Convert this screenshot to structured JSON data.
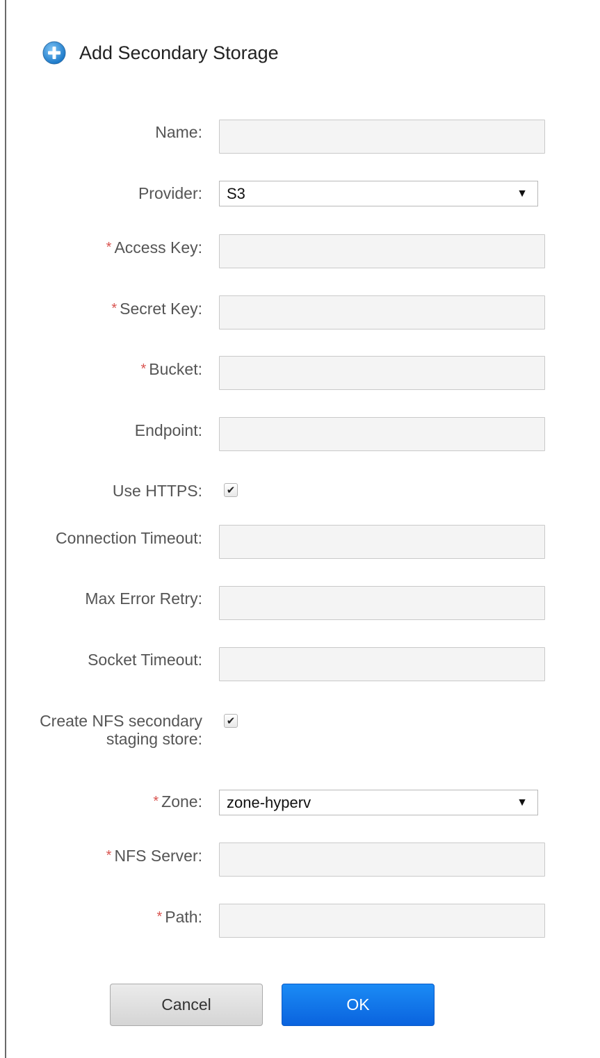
{
  "dialog": {
    "title": "Add Secondary Storage",
    "icon": "plus-circle-icon"
  },
  "fields": {
    "name": {
      "label": "Name:",
      "value": ""
    },
    "provider": {
      "label": "Provider:",
      "selected": "S3"
    },
    "access_key": {
      "required_marker": "*",
      "label": "Access Key:",
      "value": ""
    },
    "secret_key": {
      "required_marker": "*",
      "label": "Secret Key:",
      "value": ""
    },
    "bucket": {
      "required_marker": "*",
      "label": "Bucket:",
      "value": ""
    },
    "endpoint": {
      "label": "Endpoint:",
      "value": ""
    },
    "use_https": {
      "label": "Use HTTPS:",
      "checked": true,
      "check_glyph": "✔"
    },
    "connection_timeout": {
      "label": "Connection Timeout:",
      "value": ""
    },
    "max_error_retry": {
      "label": "Max Error Retry:",
      "value": ""
    },
    "socket_timeout": {
      "label": "Socket Timeout:",
      "value": ""
    },
    "create_nfs_staging": {
      "label": "Create NFS secondary staging store:",
      "checked": true,
      "check_glyph": "✔"
    },
    "zone": {
      "required_marker": "*",
      "label": "Zone:",
      "selected": "zone-hyperv"
    },
    "nfs_server": {
      "required_marker": "*",
      "label": "NFS Server:",
      "value": ""
    },
    "path": {
      "required_marker": "*",
      "label": "Path:",
      "value": ""
    }
  },
  "select_arrow": "▼",
  "buttons": {
    "cancel": "Cancel",
    "ok": "OK"
  },
  "colors": {
    "required": "#d9534f",
    "ok_button": "#0a63de",
    "input_bg": "#f4f4f4"
  }
}
